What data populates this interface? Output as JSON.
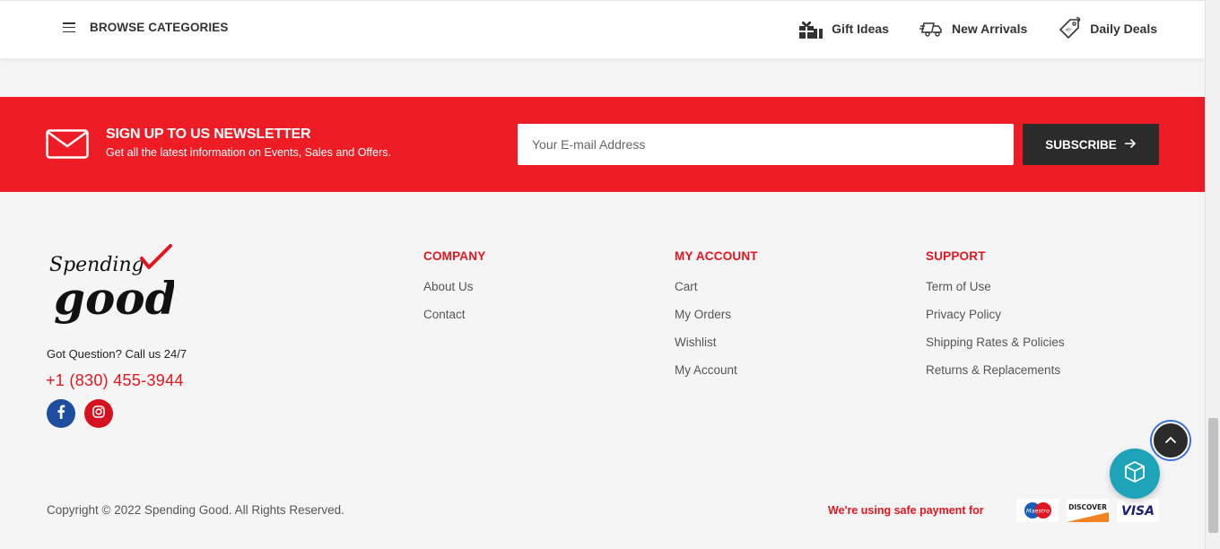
{
  "topbar": {
    "browse_label": "BROWSE CATEGORIES",
    "links": [
      {
        "label": "Gift Ideas",
        "icon": "gift-icon"
      },
      {
        "label": "New Arrivals",
        "icon": "truck-icon"
      },
      {
        "label": "Daily Deals",
        "icon": "tag-icon"
      }
    ]
  },
  "newsletter": {
    "title": "SIGN UP TO US NEWSLETTER",
    "subtitle": "Get all the latest information on Events, Sales and Offers.",
    "input_placeholder": "Your E-mail Address",
    "subscribe_label": "SUBSCRIBE",
    "accent_color": "#ee1c25"
  },
  "footer": {
    "logo_text_top": "Spending",
    "logo_text_bottom": "good",
    "question": "Got Question? Call us 24/7",
    "phone": "+1 (830) 455-3944",
    "social": [
      "facebook-icon",
      "instagram-icon"
    ],
    "company": {
      "title": "COMPANY",
      "links": [
        "About Us",
        "Contact"
      ]
    },
    "account": {
      "title": "MY ACCOUNT",
      "links": [
        "Cart",
        "My Orders",
        "Wishlist",
        "My Account"
      ]
    },
    "support": {
      "title": "SUPPORT",
      "links": [
        "Term of Use",
        "Privacy Policy",
        "Shipping Rates & Policies",
        "Returns & Replacements"
      ]
    },
    "copyright": "Copyright © 2022 Spending Good. All Rights Reserved.",
    "safe_payment": "We're using safe payment for",
    "payments": {
      "maestro": "Maestro",
      "discover": "DISCOVER",
      "visa": "VISA"
    }
  }
}
